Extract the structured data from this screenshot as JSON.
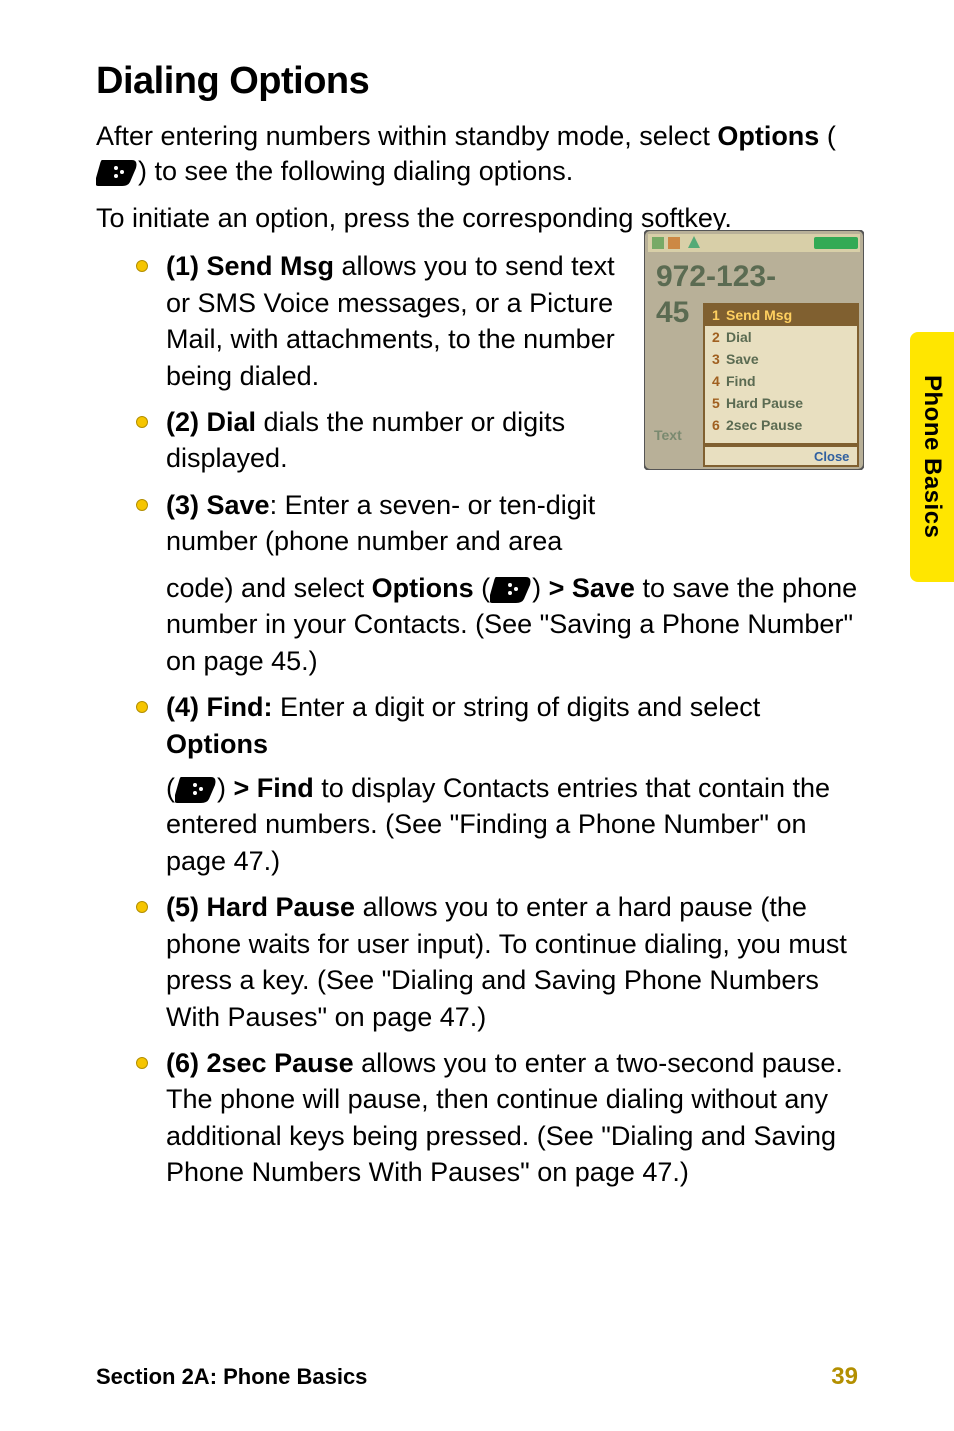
{
  "heading": "Dialing Options",
  "intro1_a": "After entering numbers within standby mode, select ",
  "intro1_b": "Options",
  "intro1_c": " (",
  "intro1_d": ") to see the following dialing options.",
  "intro2": "To initiate an option, press the corresponding softkey.",
  "items": {
    "i1_a": "(1) Send Msg",
    "i1_b": " allows you to send text or SMS Voice messages, or a Picture Mail, with attachments, to the number being dialed.",
    "i2_a": "(2) Dial",
    "i2_b": " dials the number or digits displayed.",
    "i3_a": "(3) Save",
    "i3_b": ": Enter a seven- or ten-digit number (phone number and area",
    "i3_cont_a": "code) and select ",
    "i3_cont_b": "Options",
    "i3_cont_c": " (",
    "i3_cont_d": ") ",
    "i3_cont_e": "> Save",
    "i3_cont_f": " to save the phone number in your Contacts. (See \"Saving a Phone Number\" on page 45.)",
    "i4_a": "(4) Find:",
    "i4_b": " Enter a digit or string of digits and select ",
    "i4_c": "Options",
    "i4_cont_a": "(",
    "i4_cont_b": ") ",
    "i4_cont_c": "> Find",
    "i4_cont_d": " to display Contacts entries that contain the entered numbers. (See \"Finding a Phone Number\" on page 47.)",
    "i5_a": "(5) Hard Pause",
    "i5_b": " allows you to enter a hard pause (the phone waits for user input). To continue dialing, you must press a key. (See \"Dialing and Saving Phone Numbers With Pauses\" on page 47.)",
    "i6_a": "(6) 2sec Pause",
    "i6_b": " allows you to enter a two-second pause. The phone will pause, then continue dialing without any additional keys being pressed. (See \"Dialing and Saving Phone Numbers With Pauses\" on page 47.)"
  },
  "side_tab": "Phone Basics",
  "footer_left": "Section 2A: Phone Basics",
  "footer_right": "39",
  "screenshot": {
    "number_big": "972-123-",
    "number_small_left": "45",
    "text_label": "Text",
    "close_label": "Close",
    "menu": {
      "m1": "Send Msg",
      "m2": "Dial",
      "m3": "Save",
      "m4": "Find",
      "m5": "Hard Pause",
      "m6": "2sec Pause",
      "n1": "1",
      "n2": "2",
      "n3": "3",
      "n4": "4",
      "n5": "5",
      "n6": "6"
    }
  }
}
